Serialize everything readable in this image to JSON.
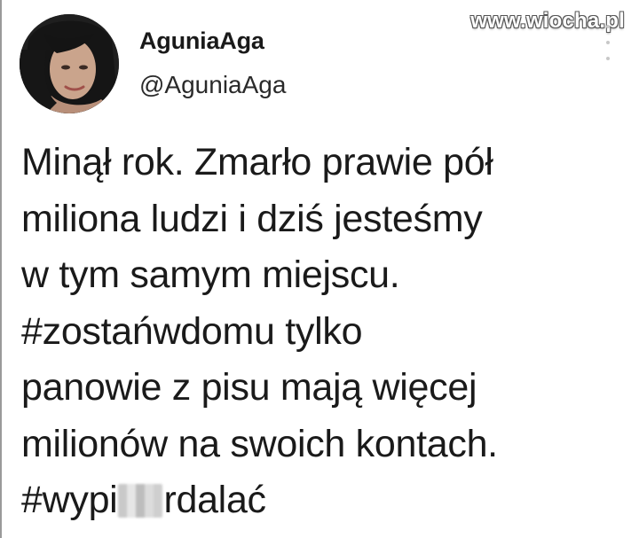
{
  "watermark": "www.wiocha.pl",
  "user": {
    "display_name": "AguniaAga",
    "handle": "@AguniaAga"
  },
  "tweet": {
    "lines": [
      "Minął rok. Zmarło prawie pół",
      "miliona ludzi i dziś jesteśmy",
      "w tym samym miejscu.",
      "#zostańwdomu tylko",
      "panowie z pisu mają więcej",
      "milionów na swoich kontach."
    ],
    "last_line_before": "#wypi",
    "last_line_after": "rdalać"
  },
  "icons": {
    "avatar": "profile-photo",
    "more": "more-vertical-icon"
  },
  "colors": {
    "text": "#1a1a1a",
    "background": "#ffffff"
  }
}
